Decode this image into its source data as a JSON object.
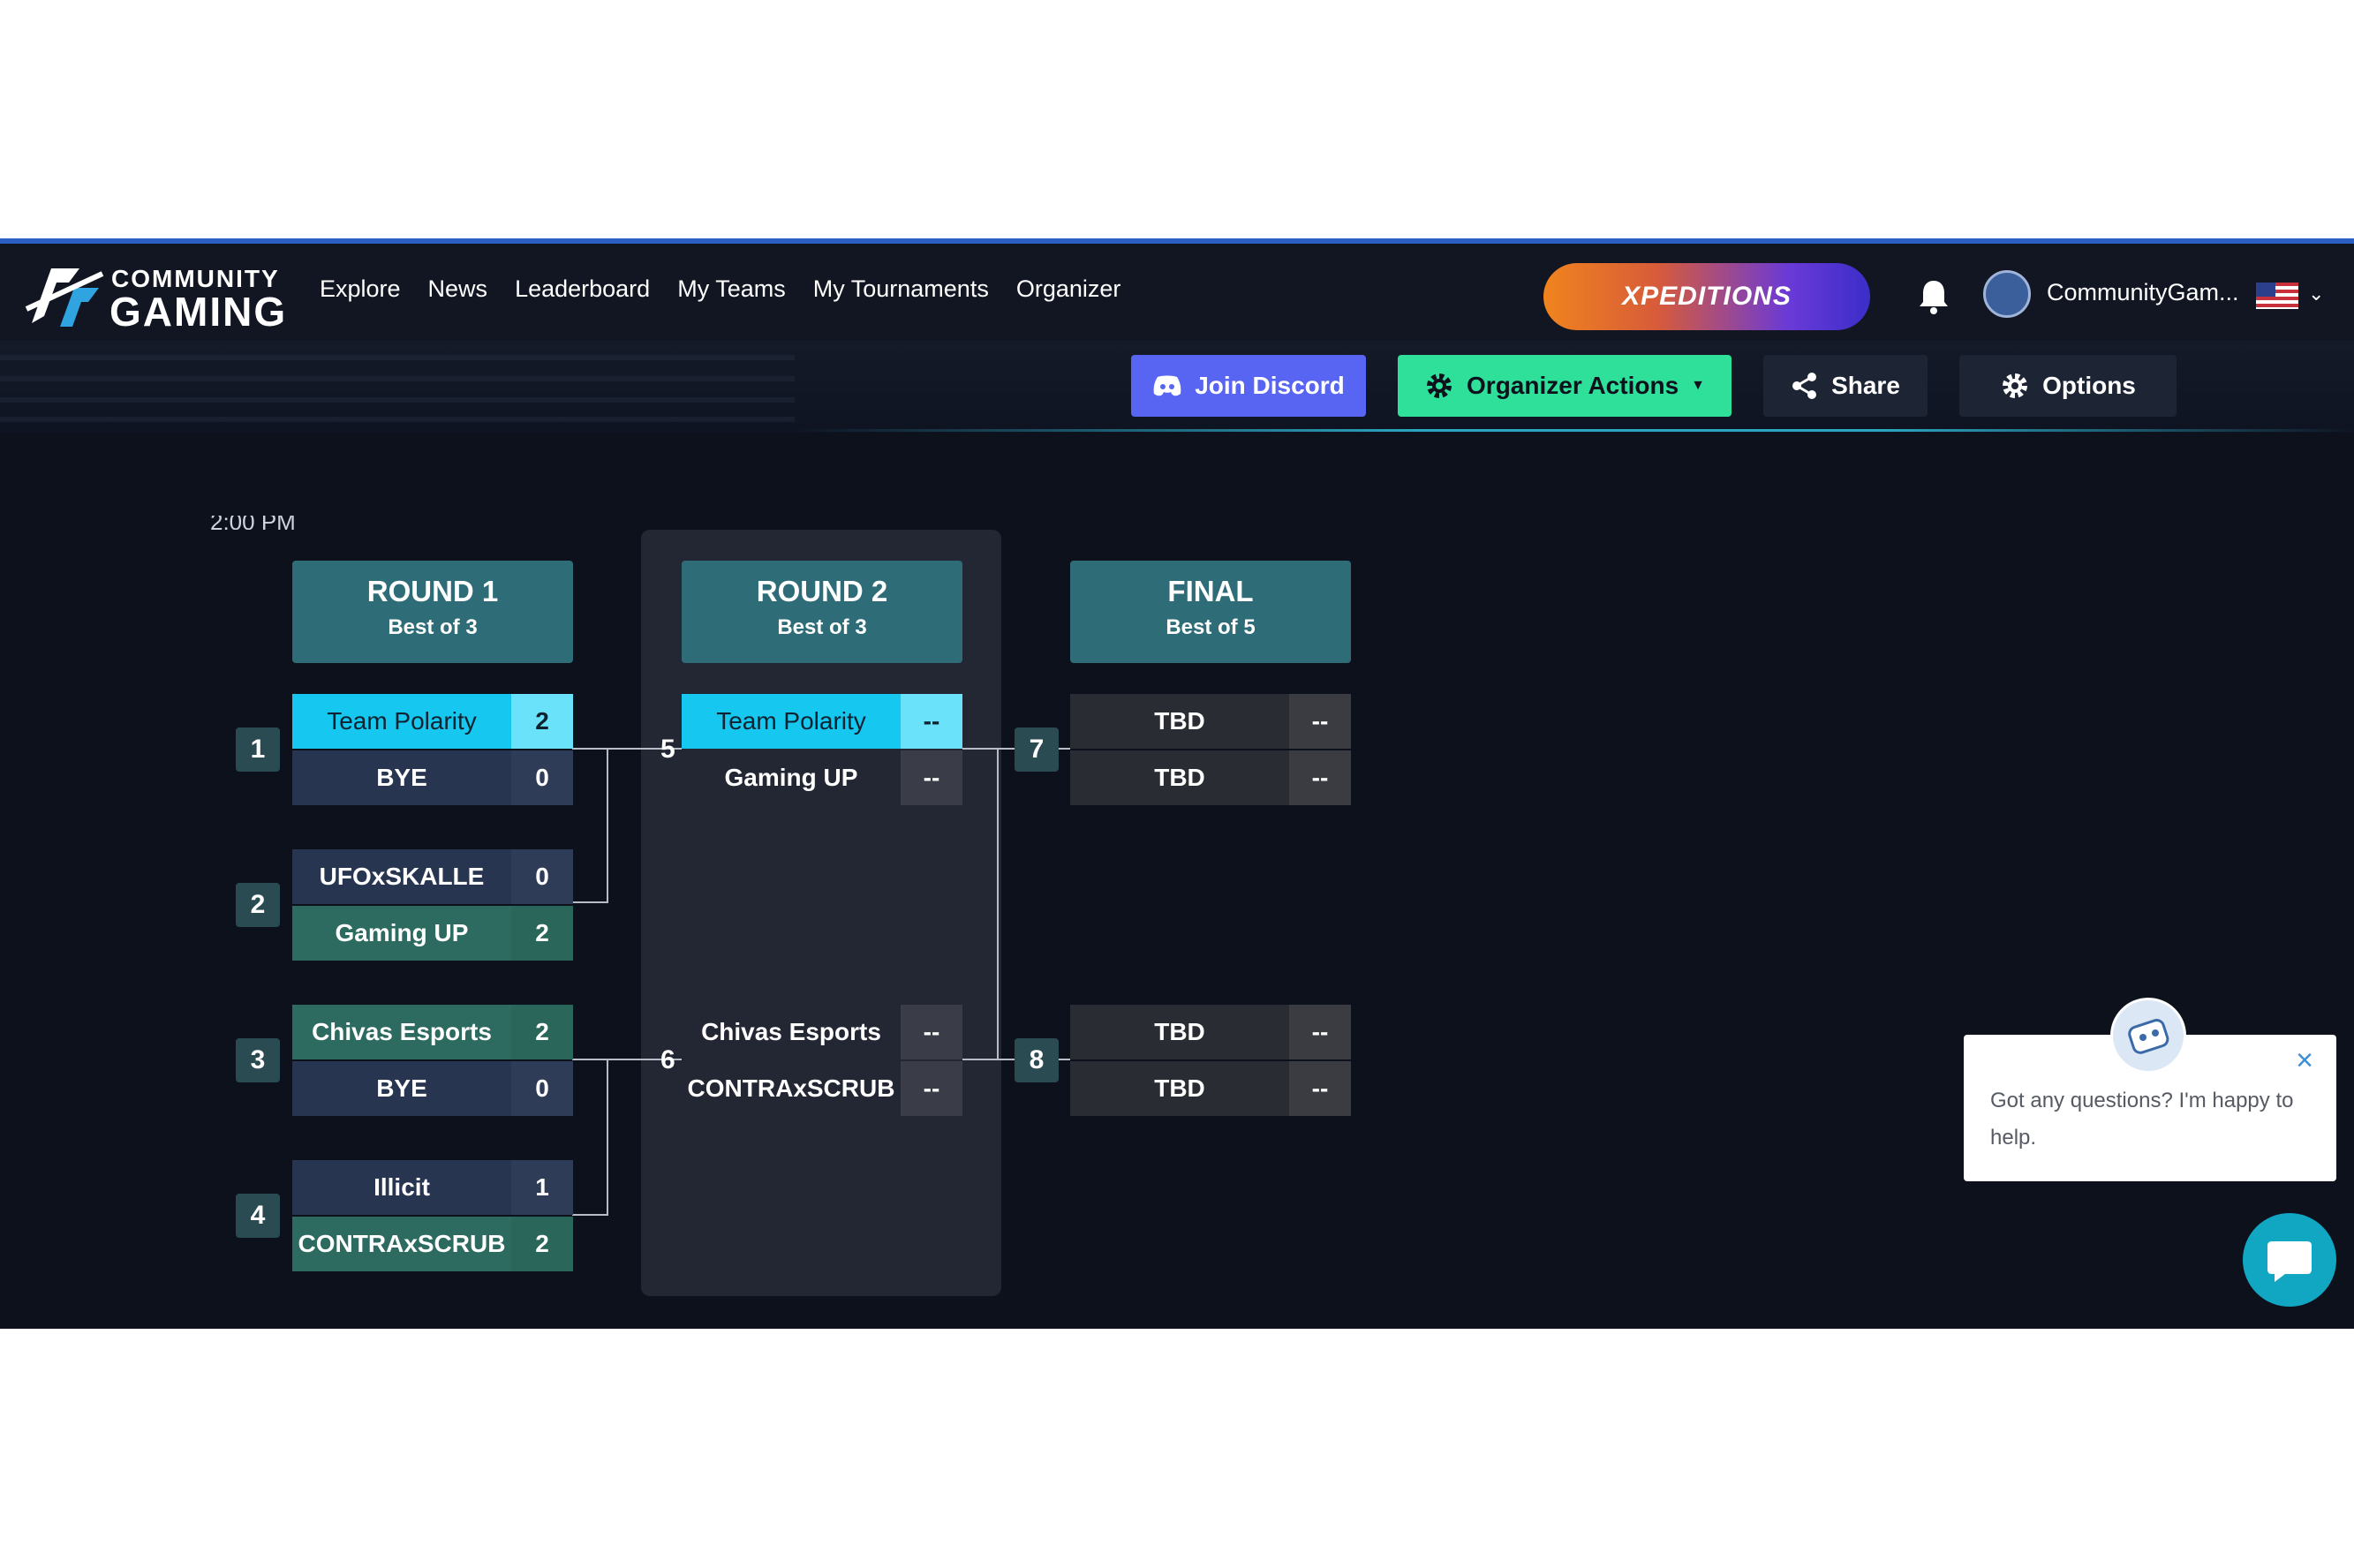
{
  "nav": {
    "brand_line1": "COMMUNITY",
    "brand_line2": "GAMING",
    "links": [
      "Explore",
      "News",
      "Leaderboard",
      "My Teams",
      "My Tournaments",
      "Organizer"
    ],
    "promo": "XPEDITIONS",
    "username": "CommunityGam...",
    "icons": {
      "notifications": "bell-icon",
      "language": "us-flag-icon"
    }
  },
  "actions": {
    "discord": "Join Discord",
    "organizer": "Organizer Actions",
    "share": "Share",
    "options": "Options"
  },
  "partial_time": "2:00 PM",
  "rounds": [
    {
      "title": "ROUND 1",
      "subtitle": "Best of 3"
    },
    {
      "title": "ROUND 2",
      "subtitle": "Best of 3"
    },
    {
      "title": "FINAL",
      "subtitle": "Best of 5"
    }
  ],
  "matches": [
    {
      "num": "1",
      "teams": [
        {
          "name": "Team Polarity",
          "score": "2"
        },
        {
          "name": "BYE",
          "score": "0"
        }
      ]
    },
    {
      "num": "2",
      "teams": [
        {
          "name": "UFOxSKALLE",
          "score": "0"
        },
        {
          "name": "Gaming UP",
          "score": "2"
        }
      ]
    },
    {
      "num": "3",
      "teams": [
        {
          "name": "Chivas Esports",
          "score": "2"
        },
        {
          "name": "BYE",
          "score": "0"
        }
      ]
    },
    {
      "num": "4",
      "teams": [
        {
          "name": "Illicit",
          "score": "1"
        },
        {
          "name": "CONTRAxSCRUB",
          "score": "2"
        }
      ]
    },
    {
      "num": "5",
      "teams": [
        {
          "name": "Team Polarity",
          "score": "--"
        },
        {
          "name": "Gaming UP",
          "score": "--"
        }
      ]
    },
    {
      "num": "6",
      "teams": [
        {
          "name": "Chivas Esports",
          "score": "--"
        },
        {
          "name": "CONTRAxSCRUB",
          "score": "--"
        }
      ]
    },
    {
      "num": "7",
      "teams": [
        {
          "name": "TBD",
          "score": "--"
        },
        {
          "name": "TBD",
          "score": "--"
        }
      ]
    },
    {
      "num": "8",
      "teams": [
        {
          "name": "TBD",
          "score": "--"
        },
        {
          "name": "TBD",
          "score": "--"
        }
      ]
    }
  ],
  "chat": {
    "message": "Got any questions? I'm happy to help.",
    "close_icon": "close-icon",
    "launcher_icon": "chat-icon"
  },
  "colors": {
    "background": "#0d111c",
    "highlight": "#16c7f0",
    "winner": "#2d6b61",
    "round_header": "#2e6d78",
    "organizer_button": "#2fe09b",
    "discord_button": "#5865f2"
  }
}
